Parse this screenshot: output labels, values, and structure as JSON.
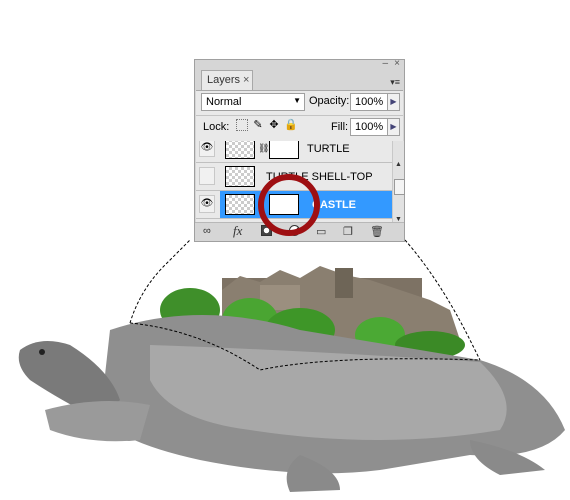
{
  "panel": {
    "tab_label": "Layers",
    "tab_close": "×",
    "minimize": "–",
    "close": "×",
    "menu_icon": "▾≡",
    "blend_mode": "Normal",
    "opacity_label": "Opacity:",
    "opacity_value": "100%",
    "lock_label": "Lock:",
    "fill_label": "Fill:",
    "fill_value": "100%"
  },
  "layers": [
    {
      "name": "TURTLE",
      "visible": true,
      "has_mask": true,
      "selected": false
    },
    {
      "name": "TURTLE SHELL-TOP",
      "visible": false,
      "has_mask": false,
      "selected": false
    },
    {
      "name": "CASTLE",
      "visible": true,
      "has_mask": true,
      "selected": true
    }
  ],
  "bottom_icons": [
    "link-icon",
    "fx-icon",
    "add-mask-icon",
    "adjustment-layer-icon",
    "group-folder-icon",
    "new-layer-icon",
    "trash-icon"
  ],
  "labels": {
    "fx": "fx"
  },
  "colors": {
    "selection": "#3399ff",
    "highlight_circle": "#9e0f12"
  }
}
